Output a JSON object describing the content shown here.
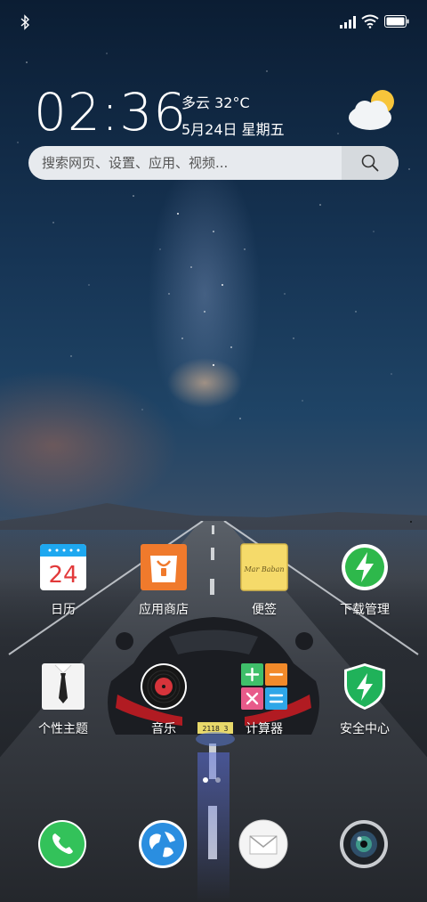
{
  "statusbar": {
    "left_icons": [
      "bluetooth-icon"
    ],
    "right_icons": [
      "signal-icon",
      "wifi-icon",
      "battery-icon"
    ]
  },
  "clock_widget": {
    "time": "02:36",
    "weather": "多云 32°C",
    "date": "5月24日 星期五",
    "weather_icon": "partly-cloudy-icon"
  },
  "search": {
    "placeholder": "搜索网页、设置、应用、视频...",
    "icon": "search-icon"
  },
  "apps": [
    {
      "id": "calendar",
      "label": "日历",
      "icon": "calendar-icon",
      "day": "24"
    },
    {
      "id": "app-store",
      "label": "应用商店",
      "icon": "shopping-bag-icon"
    },
    {
      "id": "notes",
      "label": "便签",
      "icon": "notes-icon",
      "note_text": "Mar Baban"
    },
    {
      "id": "downloads",
      "label": "下载管理",
      "icon": "lightning-icon"
    },
    {
      "id": "themes",
      "label": "个性主题",
      "icon": "shirt-tie-icon"
    },
    {
      "id": "music",
      "label": "音乐",
      "icon": "vinyl-record-icon"
    },
    {
      "id": "calculator",
      "label": "计算器",
      "icon": "calculator-icon"
    },
    {
      "id": "security",
      "label": "安全中心",
      "icon": "shield-lightning-icon"
    }
  ],
  "page_indicator": {
    "pages": 2,
    "current": 1
  },
  "dock": [
    {
      "id": "phone",
      "icon": "phone-icon"
    },
    {
      "id": "browser",
      "icon": "globe-icon"
    },
    {
      "id": "messages",
      "icon": "envelope-icon"
    },
    {
      "id": "camera",
      "icon": "camera-lens-icon"
    }
  ],
  "wallpaper": {
    "scene": "starry-sky-road-car",
    "license_plate": "2118 3"
  },
  "colors": {
    "calendar_top": "#1ea8f0",
    "calendar_day": "#e2393a",
    "store": "#f07a2c",
    "notes": "#f5da6a",
    "download_green": "#2eb84b",
    "security_green": "#20b25a",
    "phone_green": "#33c25a",
    "search_bg": "#e7eaee"
  }
}
